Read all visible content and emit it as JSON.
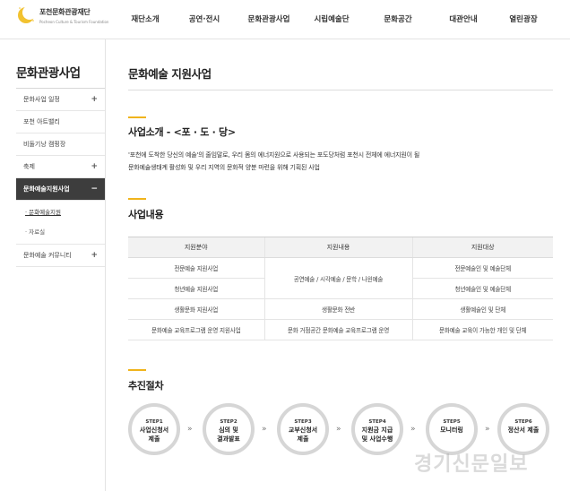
{
  "header": {
    "logo_name": "포천문화관광재단",
    "logo_sub": "Pocheon Culture & Tourism Foundation",
    "nav": [
      "재단소개",
      "공연·전시",
      "문화관광사업",
      "시립예술단",
      "문화공간",
      "대관안내",
      "열린광장"
    ]
  },
  "sidebar": {
    "title": "문화관광사업",
    "items": [
      {
        "label": "문화사업 일정",
        "plus": "+"
      },
      {
        "label": "포천 아트밸리",
        "plus": ""
      },
      {
        "label": "비둘기낭 캠핑장",
        "plus": ""
      },
      {
        "label": "축제",
        "plus": "+"
      },
      {
        "label": "문화예술지원사업",
        "plus": "−"
      },
      {
        "label": "문화예술 커뮤니티",
        "plus": "+"
      }
    ],
    "subitems": [
      "· 문화예술지원",
      "· 자료실"
    ]
  },
  "main": {
    "page_title": "문화예술 지원사업",
    "intro": {
      "heading": "사업소개 - <포 · 도 · 당>",
      "line1": "'포천에 도착한 당신의 예술'의 줄임말로, 우리 몸의 에너지원으로 사용되는 포도당처럼 포천시 전체에 에너지원이 될",
      "line2": "문화예술생태계 활성화 및 우리 지역의 문화적 양분 마련을 위해 기획된 사업"
    },
    "content": {
      "heading": "사업내용",
      "table": {
        "headers": [
          "지원분야",
          "지원내용",
          "지원대상"
        ],
        "rows": [
          {
            "field": "전문예술 지원사업",
            "content": "공연예술 / 시각예술 / 문학 / 나윈예술",
            "target": "전문예술인 및 예술단체"
          },
          {
            "field": "청년예술 지원사업",
            "target": "청년예술인 및 예술단체"
          },
          {
            "field": "생활문화 지원사업",
            "content": "생활문화 전반",
            "target": "생활예술인 및 단체"
          },
          {
            "field": "문화예술 교육프로그램 운영 지원사업",
            "content": "문화 거점공간 문화예술 교육프로그램 운영",
            "target": "문화예술 교육이 가능한 개인 및 단체"
          }
        ]
      }
    },
    "process": {
      "heading": "추진절차",
      "steps": [
        {
          "no": "STEP1",
          "label": "사업신청서\n제출"
        },
        {
          "no": "STEP2",
          "label": "심의 및\n결과발표"
        },
        {
          "no": "STEP3",
          "label": "교부신청서\n제출"
        },
        {
          "no": "STEP4",
          "label": "지원금 지급\n및 사업수행"
        },
        {
          "no": "STEP5",
          "label": "모니터링"
        },
        {
          "no": "STEP6",
          "label": "정산서 제출"
        }
      ],
      "arrow": "»"
    }
  },
  "watermark": "경기신문일보",
  "colors": {
    "accent": "#f0b41c",
    "active_bg": "#3d3d3d",
    "moon": "#f2c230"
  }
}
